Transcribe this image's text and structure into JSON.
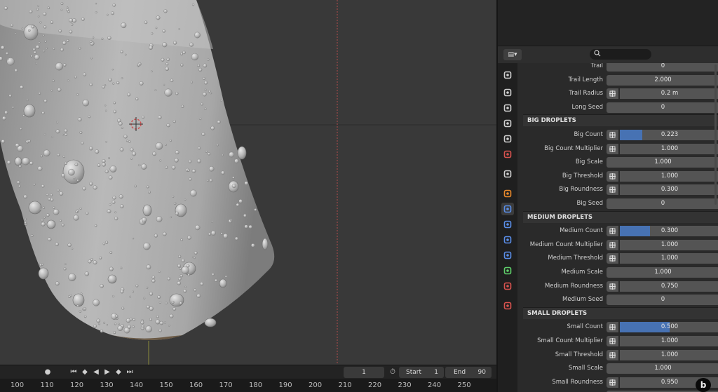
{
  "timeline": {
    "current_frame": "1",
    "start_label": "Start",
    "start_value": "1",
    "end_label": "End",
    "end_value": "90",
    "ruler_ticks": [
      "100",
      "110",
      "120",
      "130",
      "140",
      "150",
      "160",
      "170",
      "180",
      "190",
      "200",
      "210",
      "220",
      "230",
      "240",
      "250"
    ]
  },
  "properties": {
    "editor_type_icon": "editor-type-icon",
    "search_placeholder": "",
    "top_rows": [
      {
        "label": "Trail",
        "value": "0",
        "has_keyframe": false
      },
      {
        "label": "Trail Length",
        "value": "2.000",
        "has_keyframe": false
      },
      {
        "label": "Trail Radius",
        "value": "0.2 m",
        "has_keyframe": true
      },
      {
        "label": "Long Seed",
        "value": "0",
        "has_keyframe": false
      }
    ],
    "panels": [
      {
        "title": "BIG DROPLETS",
        "rows": [
          {
            "label": "Big Count",
            "value": "0.223",
            "has_keyframe": true,
            "fill": 0.223
          },
          {
            "label": "Big Count Multiplier",
            "value": "1.000",
            "has_keyframe": true
          },
          {
            "label": "Big Scale",
            "value": "1.000",
            "has_keyframe": false
          },
          {
            "label": "Big Threshold",
            "value": "1.000",
            "has_keyframe": true
          },
          {
            "label": "Big Roundness",
            "value": "0.300",
            "has_keyframe": true
          },
          {
            "label": "Big Seed",
            "value": "0",
            "has_keyframe": false
          }
        ]
      },
      {
        "title": "MEDIUM DROPLETS",
        "rows": [
          {
            "label": "Medium Count",
            "value": "0.300",
            "has_keyframe": true,
            "fill": 0.3
          },
          {
            "label": "Medium Count Multiplier",
            "value": "1.000",
            "has_keyframe": true
          },
          {
            "label": "Medium Threshold",
            "value": "1.000",
            "has_keyframe": true
          },
          {
            "label": "Medium Scale",
            "value": "1.000",
            "has_keyframe": false
          },
          {
            "label": "Medium Roundness",
            "value": "0.750",
            "has_keyframe": true
          },
          {
            "label": "Medium Seed",
            "value": "0",
            "has_keyframe": false
          }
        ]
      },
      {
        "title": "SMALL DROPLETS",
        "rows": [
          {
            "label": "Small Count",
            "value": "0.500",
            "has_keyframe": true,
            "fill": 0.5
          },
          {
            "label": "Small Count Multiplier",
            "value": "1.000",
            "has_keyframe": true
          },
          {
            "label": "Small Threshold",
            "value": "1.000",
            "has_keyframe": true
          },
          {
            "label": "Small Scale",
            "value": "1.000",
            "has_keyframe": false
          },
          {
            "label": "Small Roundness",
            "value": "0.950",
            "has_keyframe": true
          },
          {
            "label": "Small Seed",
            "value": "0",
            "has_keyframe": false
          }
        ]
      }
    ],
    "tabs": [
      {
        "name": "tool-tab-icon",
        "color": "#cfcfcf"
      },
      {
        "name": "render-tab-icon",
        "color": "#cfcfcf"
      },
      {
        "name": "output-tab-icon",
        "color": "#cfcfcf"
      },
      {
        "name": "view-layer-tab-icon",
        "color": "#cfcfcf"
      },
      {
        "name": "scene-tab-icon",
        "color": "#cfcfcf"
      },
      {
        "name": "world-tab-icon",
        "color": "#d9534f"
      },
      {
        "name": "collection-tab-icon",
        "color": "#cfcfcf"
      },
      {
        "name": "object-tab-icon",
        "color": "#e8892b"
      },
      {
        "name": "modifier-tab-icon",
        "color": "#5a8ee8"
      },
      {
        "name": "particles-tab-icon",
        "color": "#5a8ee8"
      },
      {
        "name": "physics-tab-icon",
        "color": "#5a8ee8"
      },
      {
        "name": "constraints-tab-icon",
        "color": "#5a8ee8"
      },
      {
        "name": "data-tab-icon",
        "color": "#5fcf6a"
      },
      {
        "name": "material-tab-icon",
        "color": "#d9534f"
      },
      {
        "name": "texture-tab-icon",
        "color": "#d9534f"
      }
    ],
    "accent": "#4772b3"
  },
  "corner_logo": "b"
}
